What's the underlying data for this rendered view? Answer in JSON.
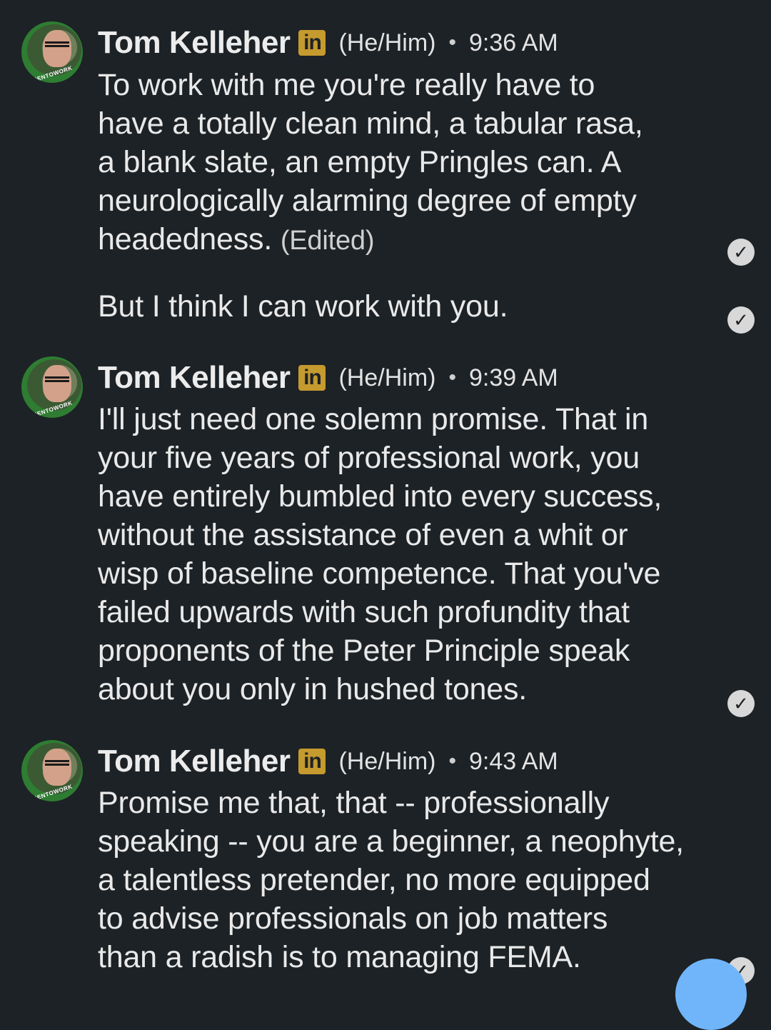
{
  "messages": [
    {
      "author": "Tom Kelleher",
      "badge": "in",
      "pronouns": "(He/Him)",
      "separator": "•",
      "time": "9:36 AM",
      "avatar_frame_text": "#OPENTOWORK",
      "paragraphs": [
        {
          "text": "To work with me you're really have to\nhave a totally clean mind, a tabular rasa,\na blank slate, an empty Pringles can.  A\nneurologically alarming degree of empty\nheadedness.",
          "suffix": "(Edited)"
        },
        {
          "text": "But I think I can work with you."
        }
      ]
    },
    {
      "author": "Tom Kelleher",
      "badge": "in",
      "pronouns": "(He/Him)",
      "separator": "•",
      "time": "9:39 AM",
      "avatar_frame_text": "#OPENTOWORK",
      "paragraphs": [
        {
          "text": "I'll just need one solemn promise.  That in\nyour five years of professional work, you\nhave entirely bumbled into every success,\nwithout the assistance of even a whit or\nwisp of baseline competence.  That you've\nfailed upwards with such profundity that\nproponents of the Peter Principle  speak\nabout you only in hushed tones."
        }
      ]
    },
    {
      "author": "Tom Kelleher",
      "badge": "in",
      "pronouns": "(He/Him)",
      "separator": "•",
      "time": "9:43 AM",
      "avatar_frame_text": "#OPENTOWORK",
      "paragraphs": [
        {
          "text": "Promise me that, that -- professionally\nspeaking -- you are a beginner, a neophyte,\na talentless pretender, no more equipped\nto advise professionals on job matters\nthan a radish is to managing FEMA."
        }
      ]
    }
  ],
  "icons": {
    "read_receipt": "check-circle-icon",
    "compose": "compose-fab-icon"
  },
  "colors": {
    "background": "#1d2226",
    "text": "#e9e9e9",
    "linkedin_badge": "#c59a2e",
    "avatar_frame": "#2e7d32",
    "fab": "#70b5f9"
  }
}
